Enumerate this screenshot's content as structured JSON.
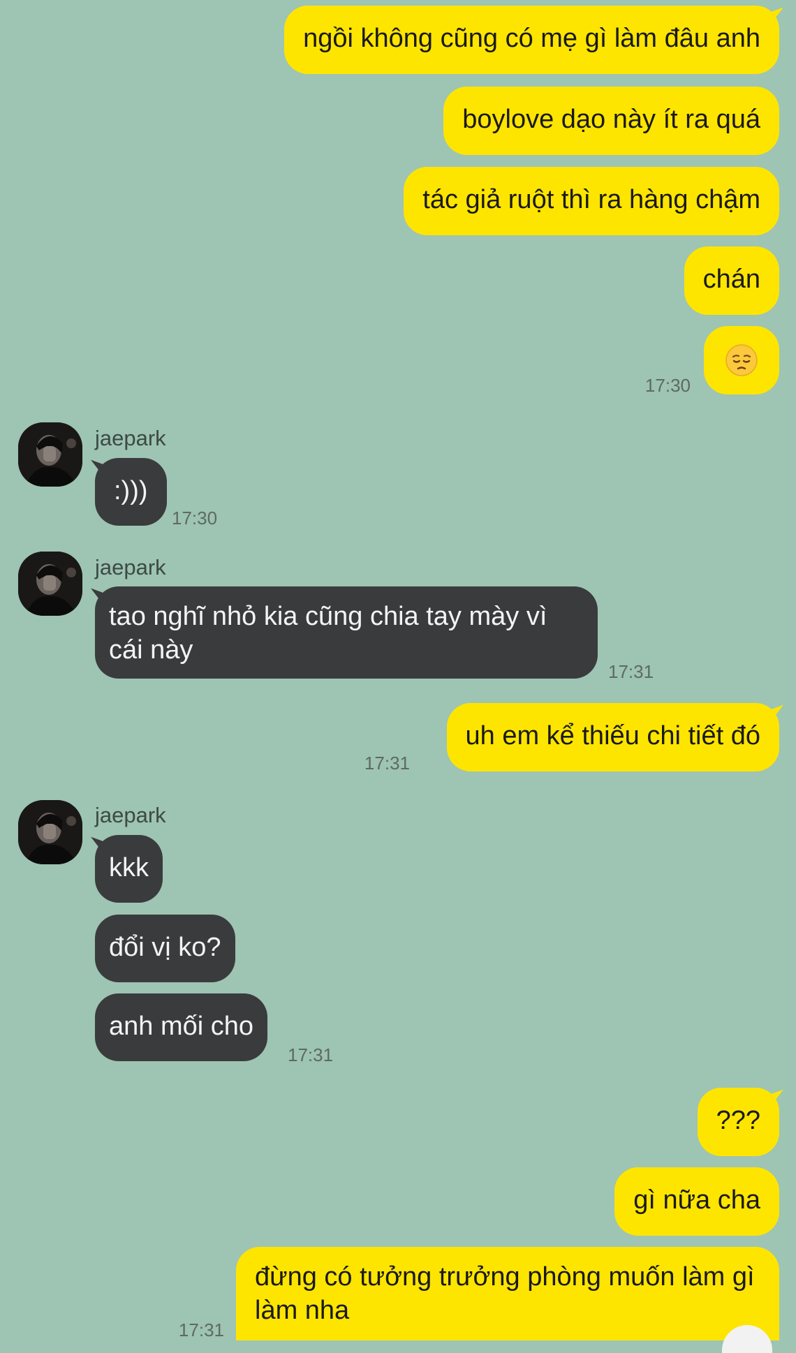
{
  "contact": {
    "name": "jaepark",
    "avatar_icon": "profile-photo"
  },
  "colors": {
    "background": "#9ec4b3",
    "outgoing_bubble": "#fee500",
    "incoming_bubble": "#3a3b3d"
  },
  "messages": [
    {
      "from": "me",
      "text": "ngồi không cũng có mẹ gì làm đâu anh"
    },
    {
      "from": "me",
      "text": "boylove dạo này ít ra quá"
    },
    {
      "from": "me",
      "text": "tác giả ruột thì ra hàng chậm"
    },
    {
      "from": "me",
      "text": "chán"
    },
    {
      "from": "me",
      "emoji": "pensive-face",
      "time": "17:30"
    },
    {
      "from": "jaepark",
      "text": ":)))",
      "time": "17:30"
    },
    {
      "from": "jaepark",
      "text": "tao nghĩ nhỏ kia cũng chia tay mày vì cái này",
      "time": "17:31"
    },
    {
      "from": "me",
      "text": "uh em kể thiếu chi tiết đó",
      "time": "17:31"
    },
    {
      "from": "jaepark",
      "text": "kkk"
    },
    {
      "from": "jaepark",
      "text": "đổi vị ko?"
    },
    {
      "from": "jaepark",
      "text": "anh mối cho",
      "time": "17:31"
    },
    {
      "from": "me",
      "text": "???"
    },
    {
      "from": "me",
      "text": "gì nữa cha"
    },
    {
      "from": "me",
      "text": "đừng có tưởng trưởng phòng muốn làm gì làm nha",
      "time": "17:31"
    }
  ]
}
